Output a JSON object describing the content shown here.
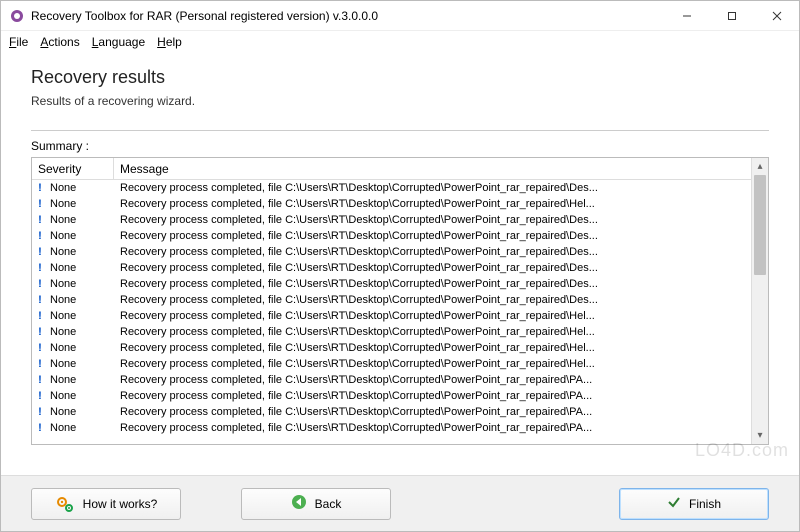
{
  "titlebar": {
    "title": "Recovery Toolbox for RAR (Personal registered version) v.3.0.0.0"
  },
  "menu": {
    "file": "File",
    "actions": "Actions",
    "language": "Language",
    "help": "Help"
  },
  "header": {
    "title": "Recovery results",
    "subtitle": "Results of a recovering wizard."
  },
  "summary_label": "Summary :",
  "columns": {
    "severity": "Severity",
    "message": "Message"
  },
  "rows": [
    {
      "severity": "None",
      "message": "Recovery process completed, file C:\\Users\\RT\\Desktop\\Corrupted\\PowerPoint_rar_repaired\\Des..."
    },
    {
      "severity": "None",
      "message": "Recovery process completed, file C:\\Users\\RT\\Desktop\\Corrupted\\PowerPoint_rar_repaired\\Hel..."
    },
    {
      "severity": "None",
      "message": "Recovery process completed, file C:\\Users\\RT\\Desktop\\Corrupted\\PowerPoint_rar_repaired\\Des..."
    },
    {
      "severity": "None",
      "message": "Recovery process completed, file C:\\Users\\RT\\Desktop\\Corrupted\\PowerPoint_rar_repaired\\Des..."
    },
    {
      "severity": "None",
      "message": "Recovery process completed, file C:\\Users\\RT\\Desktop\\Corrupted\\PowerPoint_rar_repaired\\Des..."
    },
    {
      "severity": "None",
      "message": "Recovery process completed, file C:\\Users\\RT\\Desktop\\Corrupted\\PowerPoint_rar_repaired\\Des..."
    },
    {
      "severity": "None",
      "message": "Recovery process completed, file C:\\Users\\RT\\Desktop\\Corrupted\\PowerPoint_rar_repaired\\Des..."
    },
    {
      "severity": "None",
      "message": "Recovery process completed, file C:\\Users\\RT\\Desktop\\Corrupted\\PowerPoint_rar_repaired\\Des..."
    },
    {
      "severity": "None",
      "message": "Recovery process completed, file C:\\Users\\RT\\Desktop\\Corrupted\\PowerPoint_rar_repaired\\Hel..."
    },
    {
      "severity": "None",
      "message": "Recovery process completed, file C:\\Users\\RT\\Desktop\\Corrupted\\PowerPoint_rar_repaired\\Hel..."
    },
    {
      "severity": "None",
      "message": "Recovery process completed, file C:\\Users\\RT\\Desktop\\Corrupted\\PowerPoint_rar_repaired\\Hel..."
    },
    {
      "severity": "None",
      "message": "Recovery process completed, file C:\\Users\\RT\\Desktop\\Corrupted\\PowerPoint_rar_repaired\\Hel..."
    },
    {
      "severity": "None",
      "message": "Recovery process completed, file C:\\Users\\RT\\Desktop\\Corrupted\\PowerPoint_rar_repaired\\PA..."
    },
    {
      "severity": "None",
      "message": "Recovery process completed, file C:\\Users\\RT\\Desktop\\Corrupted\\PowerPoint_rar_repaired\\PA..."
    },
    {
      "severity": "None",
      "message": "Recovery process completed, file C:\\Users\\RT\\Desktop\\Corrupted\\PowerPoint_rar_repaired\\PA..."
    },
    {
      "severity": "None",
      "message": "Recovery process completed, file C:\\Users\\RT\\Desktop\\Corrupted\\PowerPoint_rar_repaired\\PA..."
    }
  ],
  "buttons": {
    "how_it_works": "How it works?",
    "back": "Back",
    "finish": "Finish"
  },
  "watermark": "LO4D.com"
}
